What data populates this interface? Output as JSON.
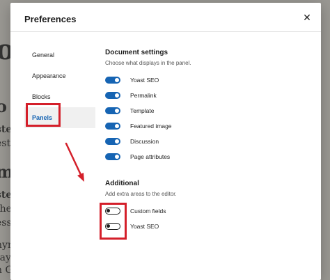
{
  "modal": {
    "title": "Preferences",
    "close_glyph": "✕"
  },
  "nav": {
    "items": [
      {
        "label": "General",
        "active": false
      },
      {
        "label": "Appearance",
        "active": false
      },
      {
        "label": "Blocks",
        "active": false
      },
      {
        "label": "Panels",
        "active": true
      }
    ]
  },
  "document_settings": {
    "title": "Document settings",
    "description": "Choose what displays in the panel.",
    "toggles": [
      {
        "label": "Yoast SEO",
        "on": true
      },
      {
        "label": "Permalink",
        "on": true
      },
      {
        "label": "Template",
        "on": true
      },
      {
        "label": "Featured image",
        "on": true
      },
      {
        "label": "Discussion",
        "on": true
      },
      {
        "label": "Page attributes",
        "on": true
      }
    ]
  },
  "additional": {
    "title": "Additional",
    "description": "Add extra areas to the editor.",
    "toggles": [
      {
        "label": "Custom fields",
        "on": false
      },
      {
        "label": "Yoast SEO",
        "on": false
      }
    ]
  },
  "background_fragments": [
    "o",
    "o w",
    "ste",
    "estr",
    "m",
    "ste",
    "the",
    "ess",
    "nyn",
    "tay",
    "n Gr",
    "Gr"
  ],
  "colors": {
    "accent": "#1664b3",
    "annotation": "#d41f2a"
  }
}
